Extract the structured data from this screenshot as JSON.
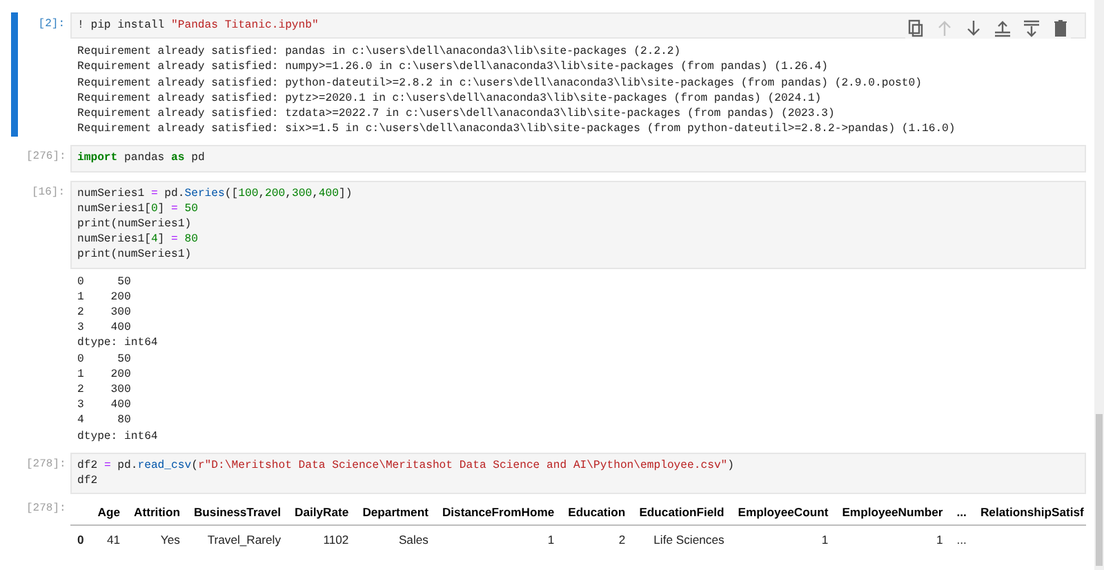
{
  "cells": [
    {
      "prompt": "[2]:",
      "selected": true,
      "toolbar": [
        {
          "kind": "duplicate",
          "disabled": false
        },
        {
          "kind": "move-up",
          "disabled": true
        },
        {
          "kind": "move-down",
          "disabled": false
        },
        {
          "kind": "insert-above",
          "disabled": false
        },
        {
          "kind": "insert-below",
          "disabled": false
        },
        {
          "kind": "delete",
          "disabled": false
        }
      ],
      "code": [
        [
          {
            "text": "! pip install ",
            "kind": "plain"
          },
          {
            "text": "\"Pandas Titanic.ipynb\"",
            "kind": "string"
          }
        ]
      ],
      "output": [
        "Requirement already satisfied: pandas in c:\\users\\dell\\anaconda3\\lib\\site-packages (2.2.2)",
        "Requirement already satisfied: numpy>=1.26.0 in c:\\users\\dell\\anaconda3\\lib\\site-packages (from pandas) (1.26.4)",
        "Requirement already satisfied: python-dateutil>=2.8.2 in c:\\users\\dell\\anaconda3\\lib\\site-packages (from pandas) (2.9.0.post0)",
        "Requirement already satisfied: pytz>=2020.1 in c:\\users\\dell\\anaconda3\\lib\\site-packages (from pandas) (2024.1)",
        "Requirement already satisfied: tzdata>=2022.7 in c:\\users\\dell\\anaconda3\\lib\\site-packages (from pandas) (2023.3)",
        "Requirement already satisfied: six>=1.5 in c:\\users\\dell\\anaconda3\\lib\\site-packages (from python-dateutil>=2.8.2->pandas) (1.16.0)"
      ]
    },
    {
      "prompt": "[276]:",
      "selected": false,
      "code": [
        [
          {
            "text": "import",
            "kind": "keyword"
          },
          {
            "text": " pandas ",
            "kind": "plain"
          },
          {
            "text": "as",
            "kind": "keyword"
          },
          {
            "text": " pd",
            "kind": "plain"
          }
        ]
      ]
    },
    {
      "prompt": "[16]:",
      "selected": false,
      "code": [
        [
          {
            "text": "numSeries1 ",
            "kind": "plain"
          },
          {
            "text": "=",
            "kind": "operator"
          },
          {
            "text": " pd.",
            "kind": "plain"
          },
          {
            "text": "Series",
            "kind": "attribute"
          },
          {
            "text": "([",
            "kind": "plain"
          },
          {
            "text": "100",
            "kind": "number"
          },
          {
            "text": ",",
            "kind": "plain"
          },
          {
            "text": "200",
            "kind": "number"
          },
          {
            "text": ",",
            "kind": "plain"
          },
          {
            "text": "300",
            "kind": "number"
          },
          {
            "text": ",",
            "kind": "plain"
          },
          {
            "text": "400",
            "kind": "number"
          },
          {
            "text": "])",
            "kind": "plain"
          }
        ],
        [
          {
            "text": "numSeries1[",
            "kind": "plain"
          },
          {
            "text": "0",
            "kind": "number"
          },
          {
            "text": "] ",
            "kind": "plain"
          },
          {
            "text": "= ",
            "kind": "operator"
          },
          {
            "text": "50",
            "kind": "number"
          }
        ],
        [
          {
            "text": "print(numSeries1)",
            "kind": "plain"
          }
        ],
        [
          {
            "text": "numSeries1[",
            "kind": "plain"
          },
          {
            "text": "4",
            "kind": "number"
          },
          {
            "text": "] ",
            "kind": "plain"
          },
          {
            "text": "= ",
            "kind": "operator"
          },
          {
            "text": "80",
            "kind": "number"
          }
        ],
        [
          {
            "text": "print(numSeries1)",
            "kind": "plain"
          }
        ]
      ],
      "output": [
        "0     50",
        "1    200",
        "2    300",
        "3    400",
        "dtype: int64",
        "0     50",
        "1    200",
        "2    300",
        "3    400",
        "4     80",
        "dtype: int64"
      ]
    },
    {
      "prompt": "[278]:",
      "selected": false,
      "code": [
        [
          {
            "text": "df2 ",
            "kind": "plain"
          },
          {
            "text": "=",
            "kind": "operator"
          },
          {
            "text": " pd.",
            "kind": "plain"
          },
          {
            "text": "read_csv",
            "kind": "attribute"
          },
          {
            "text": "(",
            "kind": "plain"
          },
          {
            "text": "r\"D:\\Meritshot Data Science\\Meritashot Data Science and AI\\Python\\employee.csv\"",
            "kind": "string"
          },
          {
            "text": ")",
            "kind": "plain"
          }
        ],
        [
          {
            "text": "df2",
            "kind": "plain"
          }
        ]
      ],
      "output_prompt": "[278]:",
      "table": {
        "columns": [
          "",
          "Age",
          "Attrition",
          "BusinessTravel",
          "DailyRate",
          "Department",
          "DistanceFromHome",
          "Education",
          "EducationField",
          "EmployeeCount",
          "EmployeeNumber",
          "...",
          "RelationshipSatisf"
        ],
        "rows": [
          [
            "0",
            "41",
            "Yes",
            "Travel_Rarely",
            "1102",
            "Sales",
            "1",
            "2",
            "Life Sciences",
            "1",
            "1",
            "...",
            ""
          ]
        ]
      }
    }
  ]
}
